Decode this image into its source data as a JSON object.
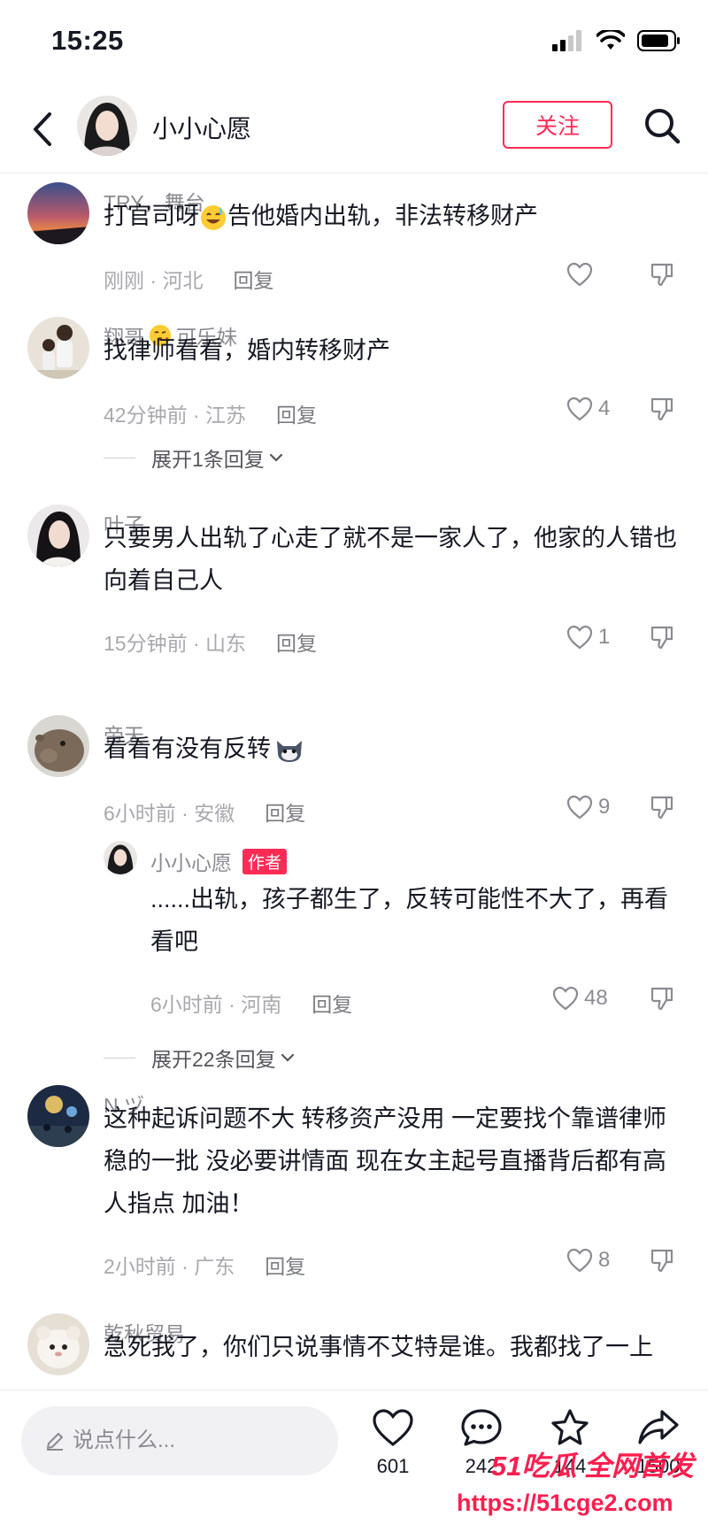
{
  "status_bar": {
    "time": "15:25"
  },
  "header": {
    "title": "小小心愿",
    "follow_label": "关注"
  },
  "comments": [
    {
      "user": "TRY，舞台",
      "text_before": "打官司呀",
      "text_after": "告他婚内出轨，非法转移财产",
      "time_location": "刚刚 · 河北",
      "reply_label": "回复",
      "likes": ""
    },
    {
      "user": "翔哥",
      "user_suffix": "可乐妹",
      "text": "找律师看看，婚内转移财产",
      "time_location": "42分钟前 · 江苏",
      "reply_label": "回复",
      "likes": "4",
      "expand_label": "展开1条回复"
    },
    {
      "user": "叶子",
      "text": "只要男人出轨了心走了就不是一家人了，他家的人错也向着自己人",
      "time_location": "15分钟前 · 山东",
      "reply_label": "回复",
      "likes": "1"
    },
    {
      "user": "帝天",
      "text": "看看有没有反转",
      "time_location": "6小时前 · 安徽",
      "reply_label": "回复",
      "likes": "9",
      "sub_reply": {
        "user": "小小心愿",
        "badge": "作者",
        "text": "......出轨，孩子都生了，反转可能性不大了，再看看吧",
        "time_location": "6小时前 · 河南",
        "reply_label": "回复",
        "likes": "48"
      },
      "expand_label": "展开22条回复"
    },
    {
      "user": "N ヅ",
      "text": "这种起诉问题不大 转移资产没用 一定要找个靠谱律师 稳的一批 没必要讲情面 现在女主起号直播背后都有高人指点 加油！",
      "time_location": "2小时前 · 广东",
      "reply_label": "回复",
      "likes": "8"
    },
    {
      "user": "乾秋贸易",
      "text": "急死我了，你们只说事情不艾特是谁。我都找了一上"
    }
  ],
  "bottom_bar": {
    "input_placeholder": "说点什么...",
    "like_count": "601",
    "comment_count": "242",
    "favorite_count": "144",
    "share_count": "1500"
  },
  "watermark": {
    "brand": "51吃瓜 全网首发",
    "url": "https://51cge2.com"
  },
  "colors": {
    "accent": "#fe2c55",
    "text": "#161823",
    "secondary": "#8a8b91",
    "watermark": "#ff1e4e"
  }
}
